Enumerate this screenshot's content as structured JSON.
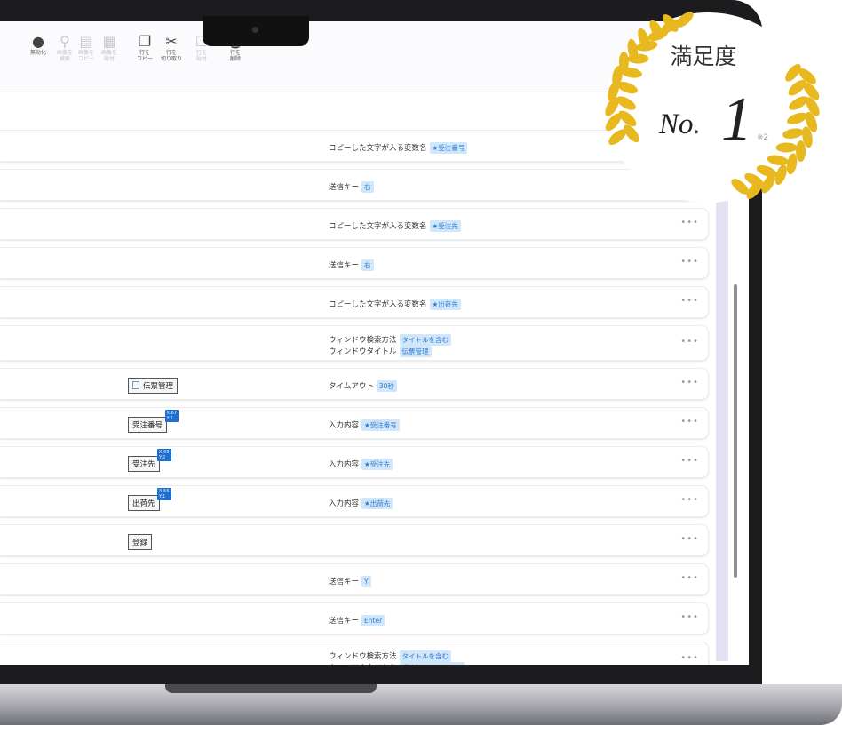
{
  "toolbar": {
    "items": [
      {
        "icon": "eye-icon",
        "glyph": "●",
        "label": "無効化",
        "dim": false
      },
      {
        "icon": "search-icon",
        "glyph": "⚲",
        "label": "画像を\n検索",
        "dim": true
      },
      {
        "icon": "copy-image-icon",
        "glyph": "▤",
        "label": "画像を\nコピー",
        "dim": true
      },
      {
        "icon": "paste-image-icon",
        "glyph": "▦",
        "label": "画像を\n貼付",
        "dim": true
      },
      {
        "icon": "copy-row-icon",
        "glyph": "❐",
        "label": "行を\nコピー",
        "dim": false
      },
      {
        "icon": "cut-row-icon",
        "glyph": "✂",
        "label": "行を\n切り取り",
        "dim": false
      },
      {
        "icon": "paste-row-icon",
        "glyph": "☐",
        "label": "行を\n貼付",
        "dim": true
      },
      {
        "icon": "delete-row-icon",
        "glyph": "🗑",
        "label": "行を\n削除",
        "dim": false
      }
    ],
    "more_icon": "chevron-down-icon"
  },
  "rows": [
    {
      "lines": [
        {
          "key": "コピーした文字が入る変数名",
          "value": "★受注番号"
        }
      ]
    },
    {
      "lines": [
        {
          "key": "送信キー",
          "value": "右"
        }
      ]
    },
    {
      "lines": [
        {
          "key": "コピーした文字が入る変数名",
          "value": "★受注先"
        }
      ]
    },
    {
      "lines": [
        {
          "key": "送信キー",
          "value": "右"
        }
      ]
    },
    {
      "lines": [
        {
          "key": "コピーした文字が入る変数名",
          "value": "★出荷先"
        }
      ]
    },
    {
      "lines": [
        {
          "key": "ウィンドウ検索方法",
          "value": "タイトルを含む"
        },
        {
          "key": "ウィンドウタイトル",
          "value": "伝票管理"
        }
      ]
    },
    {
      "element": {
        "label": "伝票管理",
        "has_icon": true
      },
      "lines": [
        {
          "key": "タイムアウト",
          "value": "30秒"
        }
      ]
    },
    {
      "element": {
        "label": "受注番号",
        "pin": "X:67\nY:1"
      },
      "lines": [
        {
          "key": "入力内容",
          "value": "★受注番号"
        }
      ]
    },
    {
      "element": {
        "label": "受注先",
        "pin": "X:69\nY:2"
      },
      "lines": [
        {
          "key": "入力内容",
          "value": "★受注先"
        }
      ]
    },
    {
      "element": {
        "label": "出荷先",
        "pin": "X:56\nY:1"
      },
      "lines": [
        {
          "key": "入力内容",
          "value": "★出荷先"
        }
      ]
    },
    {
      "element": {
        "label": "登録"
      },
      "lines": []
    },
    {
      "lines": [
        {
          "key": "送信キー",
          "value": "Y"
        }
      ]
    },
    {
      "lines": [
        {
          "key": "送信キー",
          "value": "Enter"
        }
      ]
    },
    {
      "lines": [
        {
          "key": "ウィンドウ検索方法",
          "value": "タイトルを含む"
        },
        {
          "key": "ウィンドウタイトル",
          "value": "受注伝票入力リスト"
        }
      ]
    }
  ],
  "row_menu_icon": "ellipsis-icon",
  "row_menu_text": "•••",
  "badge": {
    "title": "満足度",
    "no": "No.",
    "rank": "1",
    "note": "※2",
    "laurel_color": "#e8b81f"
  }
}
